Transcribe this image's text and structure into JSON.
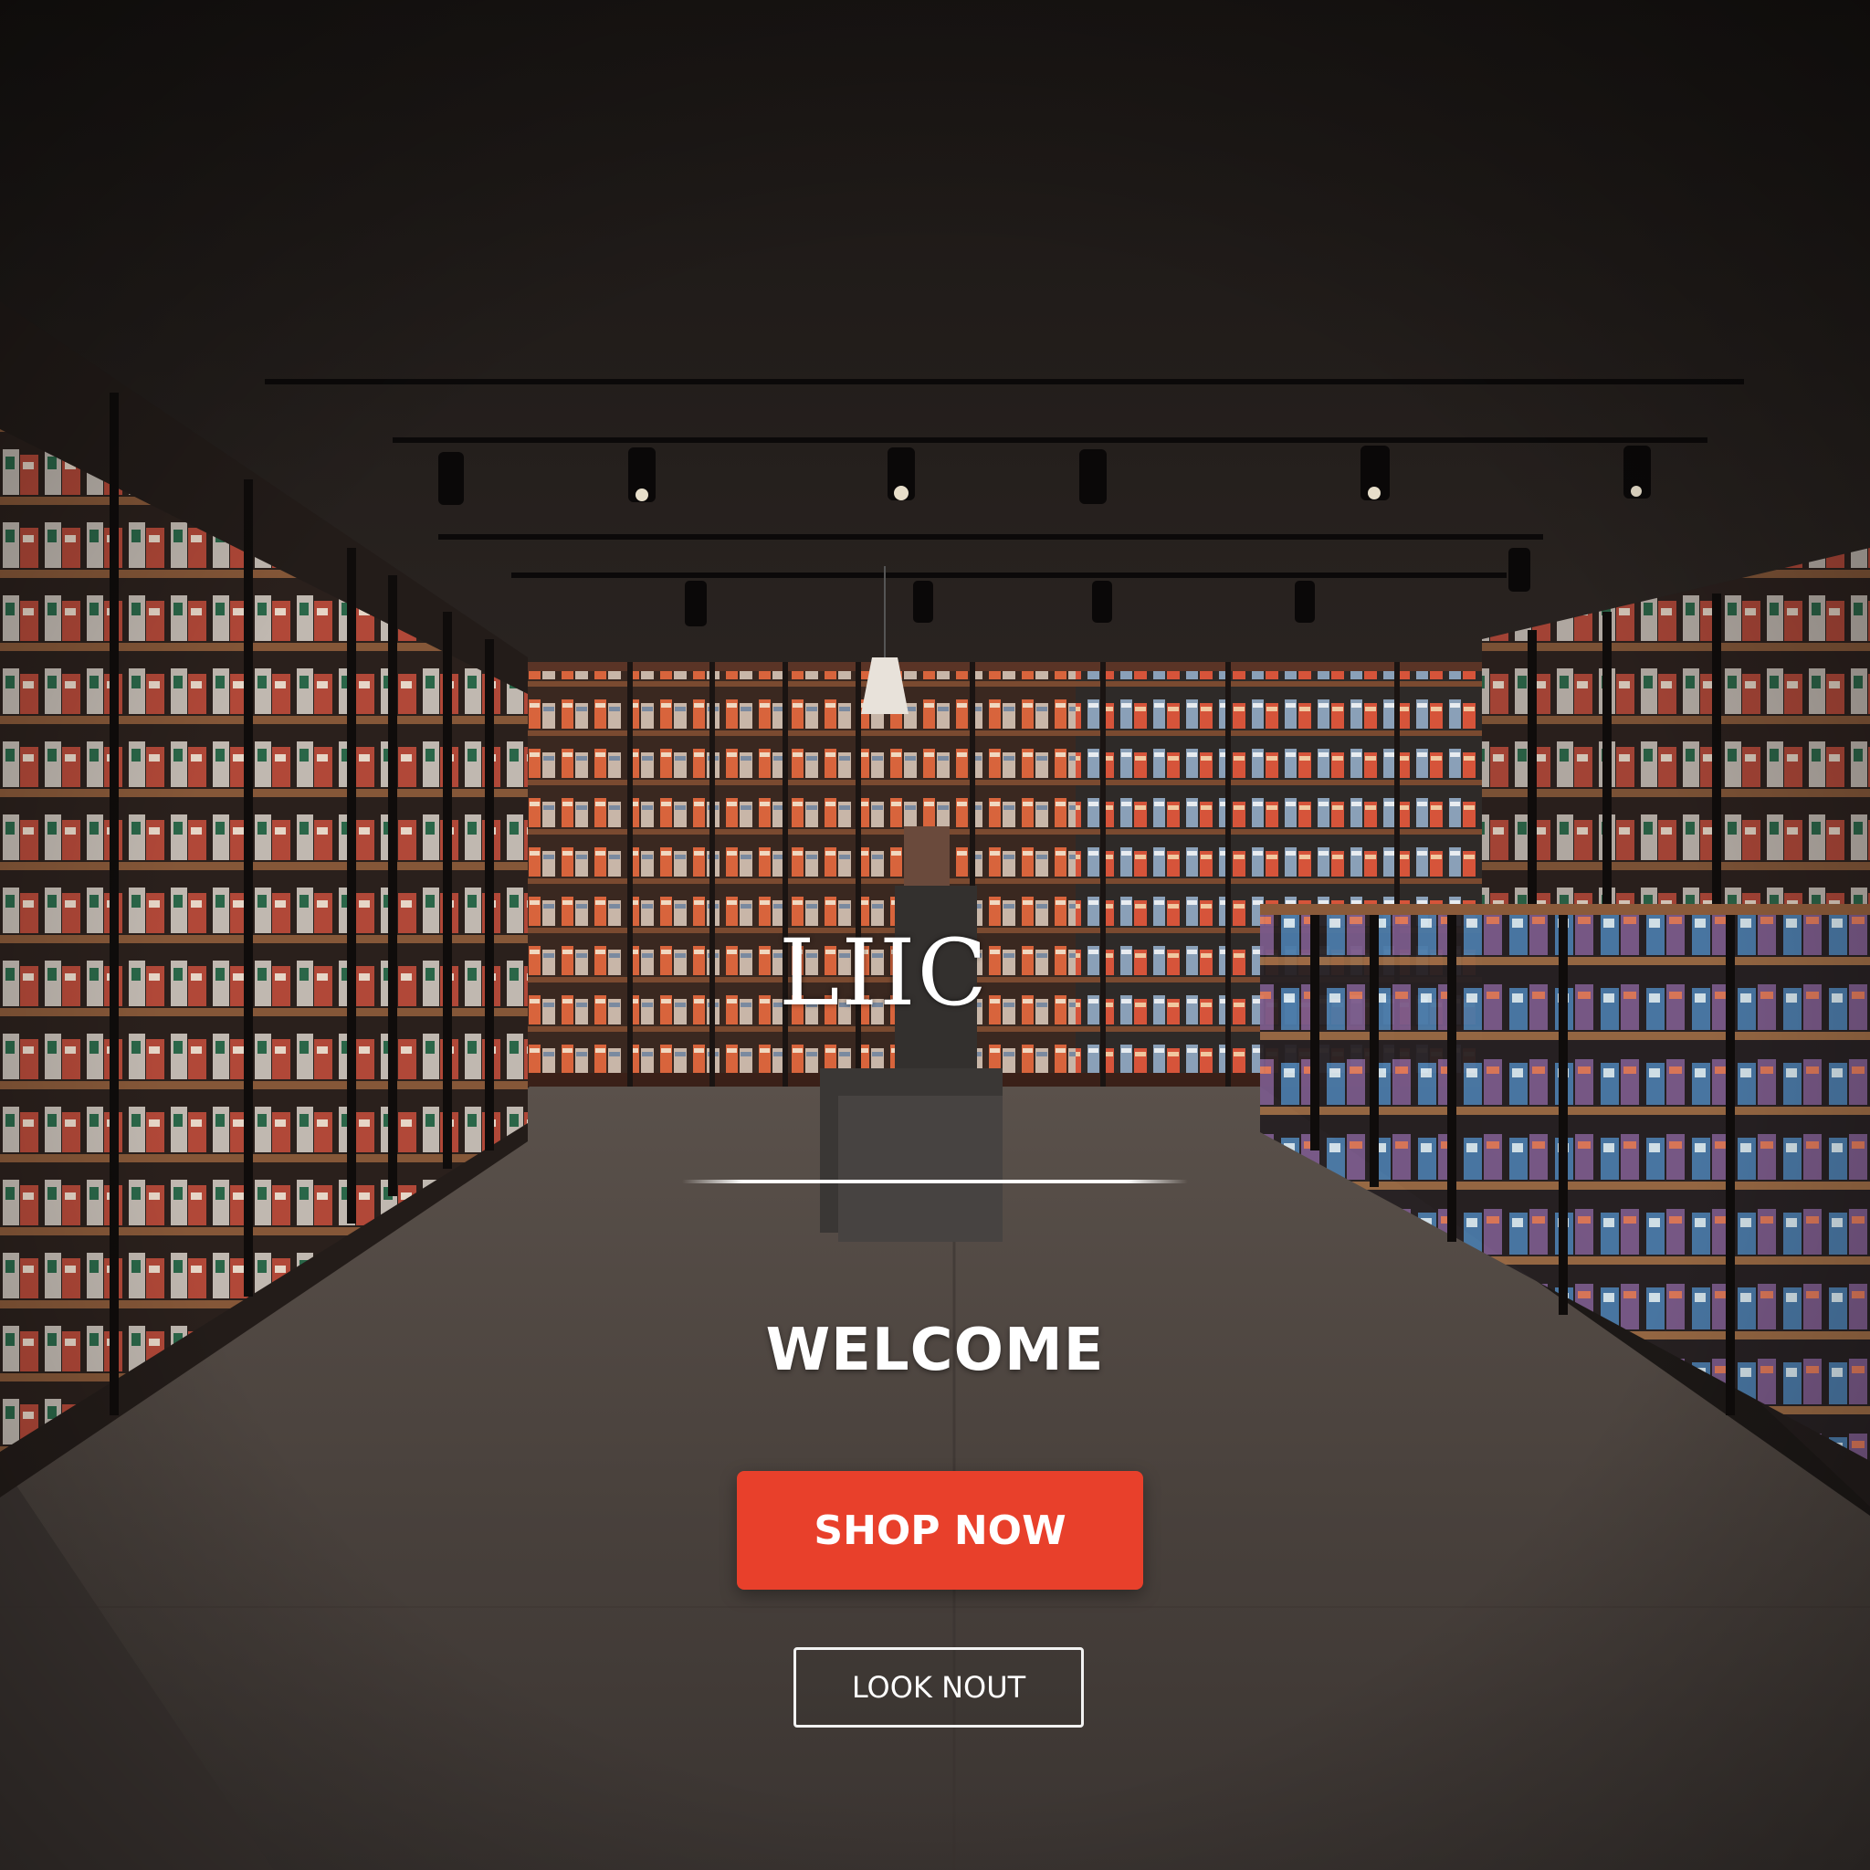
{
  "hero": {
    "logo_text": "LIIC",
    "heading": "WELCOME",
    "primary_button": {
      "label": "SHOP NOW",
      "color": "#e8402b"
    },
    "secondary_button": {
      "label": "LOOK NOUT"
    }
  }
}
